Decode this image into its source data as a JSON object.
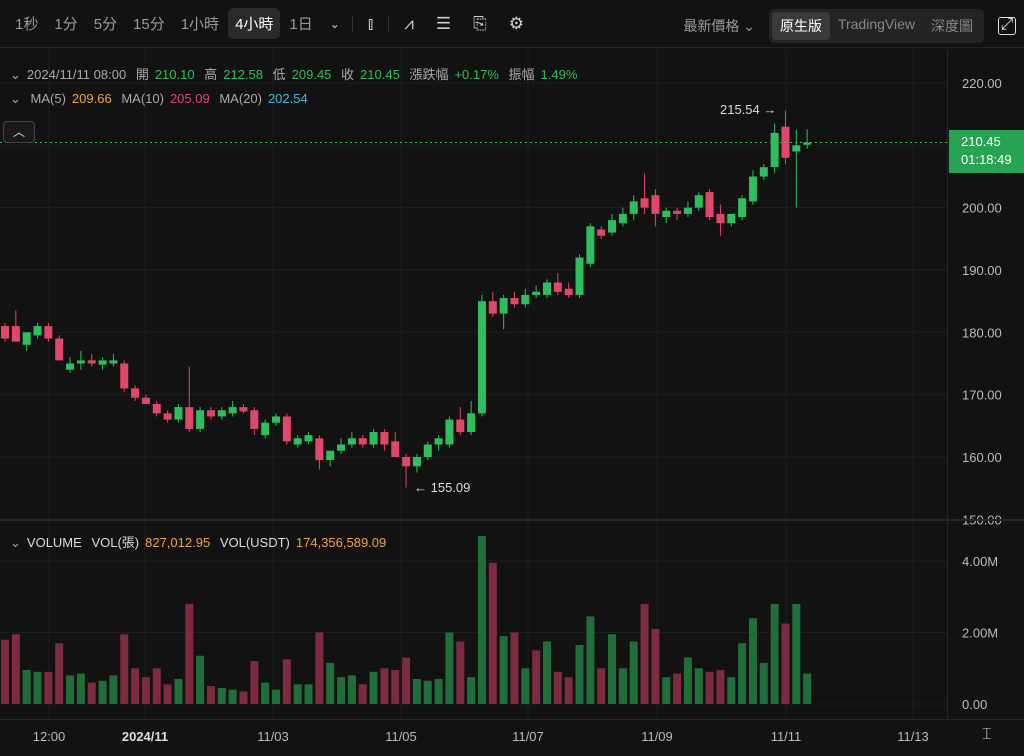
{
  "toolbar": {
    "timeframes": [
      "1秒",
      "1分",
      "5分",
      "15分",
      "1小時",
      "4小時",
      "1日"
    ],
    "active": "4小時",
    "price_type": "最新價格",
    "views": [
      "原生版",
      "TradingView",
      "深度圖"
    ],
    "active_view": "原生版"
  },
  "ohlc_legend": {
    "datetime": "2024/11/11 08:00",
    "open_label": "開",
    "open": "210.10",
    "high_label": "高",
    "high": "212.58",
    "low_label": "低",
    "low": "209.45",
    "close_label": "收",
    "close": "210.45",
    "change_label": "漲跌幅",
    "change": "+0.17%",
    "amp_label": "振幅",
    "amp": "1.49%"
  },
  "ma_legend": {
    "ma5_label": "MA(5)",
    "ma5": "209.66",
    "ma10_label": "MA(10)",
    "ma10": "205.09",
    "ma20_label": "MA(20)",
    "ma20": "202.54"
  },
  "vol_legend": {
    "title": "VOLUME",
    "vol_label": "VOL(張)",
    "vol": "827,012.95",
    "usdt_label": "VOL(USDT)",
    "usdt": "174,356,589.09"
  },
  "last_price": {
    "price": "210.45",
    "countdown": "01:18:49"
  },
  "markers": {
    "high": "215.54",
    "low": "155.09"
  },
  "colors": {
    "up": "#2ebd5f",
    "down": "#e0476a",
    "vol_up": "#1f6e3b",
    "vol_down": "#7d2b40"
  },
  "chart_data": {
    "type": "candlestick",
    "price_ticks": [
      "220.00",
      "210.00",
      "200.00",
      "190.00",
      "180.00",
      "170.00",
      "160.00",
      "150.00"
    ],
    "volume_ticks": [
      "4.00M",
      "2.00M",
      "0.00"
    ],
    "x_ticks": [
      "12:00",
      "2024/11",
      "11/03",
      "11/05",
      "11/07",
      "11/09",
      "11/11",
      "11/13"
    ],
    "ylim": [
      150,
      220
    ],
    "ohlc": [
      [
        181,
        181.5,
        178.5,
        179
      ],
      [
        181,
        183.5,
        178.5,
        178.5
      ],
      [
        178,
        180,
        177,
        180
      ],
      [
        179.5,
        181.5,
        179,
        181
      ],
      [
        181,
        181.5,
        178.5,
        179
      ],
      [
        179,
        179.5,
        175.5,
        175.5
      ],
      [
        174,
        176,
        173.5,
        175
      ],
      [
        175,
        177,
        174,
        175.5
      ],
      [
        175.5,
        176.5,
        174.5,
        175
      ],
      [
        174.8,
        176,
        174,
        175.5
      ],
      [
        175,
        176.5,
        174.5,
        175.5
      ],
      [
        175,
        175.5,
        170.5,
        171
      ],
      [
        171,
        171.5,
        169,
        169.5
      ],
      [
        169.5,
        170,
        168.5,
        168.5
      ],
      [
        168.5,
        169,
        166.5,
        167
      ],
      [
        167,
        167.5,
        165.5,
        166
      ],
      [
        166,
        168.5,
        165.5,
        168
      ],
      [
        168,
        174.5,
        164,
        164.5
      ],
      [
        164.5,
        168,
        164,
        167.5
      ],
      [
        167.5,
        168,
        166,
        166.5
      ],
      [
        166.5,
        168,
        166,
        167.5
      ],
      [
        167,
        169,
        166.5,
        168
      ],
      [
        168,
        168.5,
        167,
        167.3
      ],
      [
        167.5,
        168,
        163.5,
        164.5
      ],
      [
        163.5,
        166,
        163,
        165.5
      ],
      [
        165.5,
        167,
        165,
        166.5
      ],
      [
        166.5,
        167,
        162,
        162.5
      ],
      [
        162,
        163.5,
        161.5,
        163
      ],
      [
        162.5,
        164,
        162,
        163.5
      ],
      [
        163,
        163.5,
        158,
        159.5
      ],
      [
        159.5,
        161,
        158.5,
        161
      ],
      [
        161,
        163,
        160.5,
        162
      ],
      [
        162,
        164,
        161.5,
        163
      ],
      [
        163,
        163.5,
        161.5,
        162
      ],
      [
        162,
        164.5,
        161.5,
        164
      ],
      [
        164,
        164.5,
        161,
        162
      ],
      [
        162.5,
        164,
        160,
        160
      ],
      [
        160,
        160.5,
        155.09,
        158.5
      ],
      [
        158.5,
        160.5,
        157.5,
        160
      ],
      [
        160,
        162.5,
        159.5,
        162
      ],
      [
        162,
        163.5,
        161,
        163
      ],
      [
        162,
        166.5,
        161.5,
        166
      ],
      [
        166,
        168,
        163.5,
        164
      ],
      [
        164,
        169,
        163.5,
        167
      ],
      [
        167,
        186,
        166.5,
        185
      ],
      [
        185,
        186.5,
        182.5,
        183
      ],
      [
        183,
        186,
        180.5,
        185.5
      ],
      [
        185.5,
        186.5,
        184,
        184.5
      ],
      [
        184.5,
        187,
        184,
        186
      ],
      [
        186,
        187.5,
        185.5,
        186.5
      ],
      [
        186,
        188.5,
        185.5,
        188
      ],
      [
        188,
        189.5,
        186,
        186.5
      ],
      [
        187,
        188,
        185.5,
        186
      ],
      [
        186,
        192.5,
        185.5,
        192
      ],
      [
        191,
        197.5,
        190.5,
        197
      ],
      [
        196.5,
        197,
        195,
        195.5
      ],
      [
        196,
        199,
        195.5,
        198
      ],
      [
        197.5,
        200,
        197,
        199
      ],
      [
        199,
        202,
        198,
        201
      ],
      [
        201.5,
        205.5,
        199,
        200
      ],
      [
        202,
        203,
        197,
        199
      ],
      [
        198.5,
        200,
        197.5,
        199.5
      ],
      [
        199.5,
        200,
        198,
        199
      ],
      [
        199,
        201,
        198.5,
        200
      ],
      [
        200,
        202.5,
        199.5,
        202
      ],
      [
        202.5,
        203,
        198,
        198.5
      ],
      [
        199,
        200.5,
        195.5,
        197.5
      ],
      [
        197.5,
        199,
        197,
        199
      ],
      [
        198.5,
        202,
        198,
        201.5
      ],
      [
        201,
        206,
        200.5,
        205
      ],
      [
        205,
        207,
        204.5,
        206.5
      ],
      [
        206.5,
        213.5,
        205.5,
        212
      ],
      [
        213,
        215.54,
        207,
        208
      ],
      [
        209,
        212.5,
        200,
        210
      ],
      [
        210.1,
        212.58,
        209.45,
        210.45
      ]
    ],
    "volume_m": [
      1.8,
      1.95,
      0.95,
      0.9,
      0.9,
      1.7,
      0.8,
      0.85,
      0.6,
      0.65,
      0.8,
      1.95,
      1.0,
      0.75,
      1.0,
      0.55,
      0.7,
      2.8,
      1.35,
      0.5,
      0.45,
      0.4,
      0.35,
      1.2,
      0.6,
      0.4,
      1.25,
      0.55,
      0.55,
      2.0,
      1.15,
      0.75,
      0.8,
      0.55,
      0.9,
      1.0,
      0.95,
      1.3,
      0.7,
      0.65,
      0.7,
      2.0,
      1.75,
      0.75,
      4.7,
      3.95,
      1.9,
      2.0,
      1.0,
      1.5,
      1.75,
      0.9,
      0.75,
      1.65,
      2.45,
      1.0,
      1.95,
      1.0,
      1.75,
      2.8,
      2.1,
      0.75,
      0.85,
      1.3,
      1.0,
      0.9,
      0.95,
      0.75,
      1.7,
      2.4,
      1.15,
      2.8,
      2.25,
      2.8,
      0.85
    ],
    "volume_up": [
      0,
      0,
      1,
      1,
      0,
      0,
      1,
      1,
      0,
      1,
      1,
      0,
      0,
      0,
      0,
      0,
      1,
      0,
      1,
      0,
      1,
      1,
      0,
      0,
      1,
      1,
      0,
      1,
      1,
      0,
      1,
      1,
      1,
      0,
      1,
      0,
      0,
      0,
      1,
      1,
      1,
      1,
      0,
      1,
      1,
      0,
      1,
      0,
      1,
      0,
      1,
      0,
      0,
      1,
      1,
      0,
      1,
      1,
      1,
      0,
      0,
      1,
      0,
      1,
      1,
      0,
      0,
      1,
      1,
      1,
      1,
      1,
      0,
      1,
      1
    ]
  }
}
